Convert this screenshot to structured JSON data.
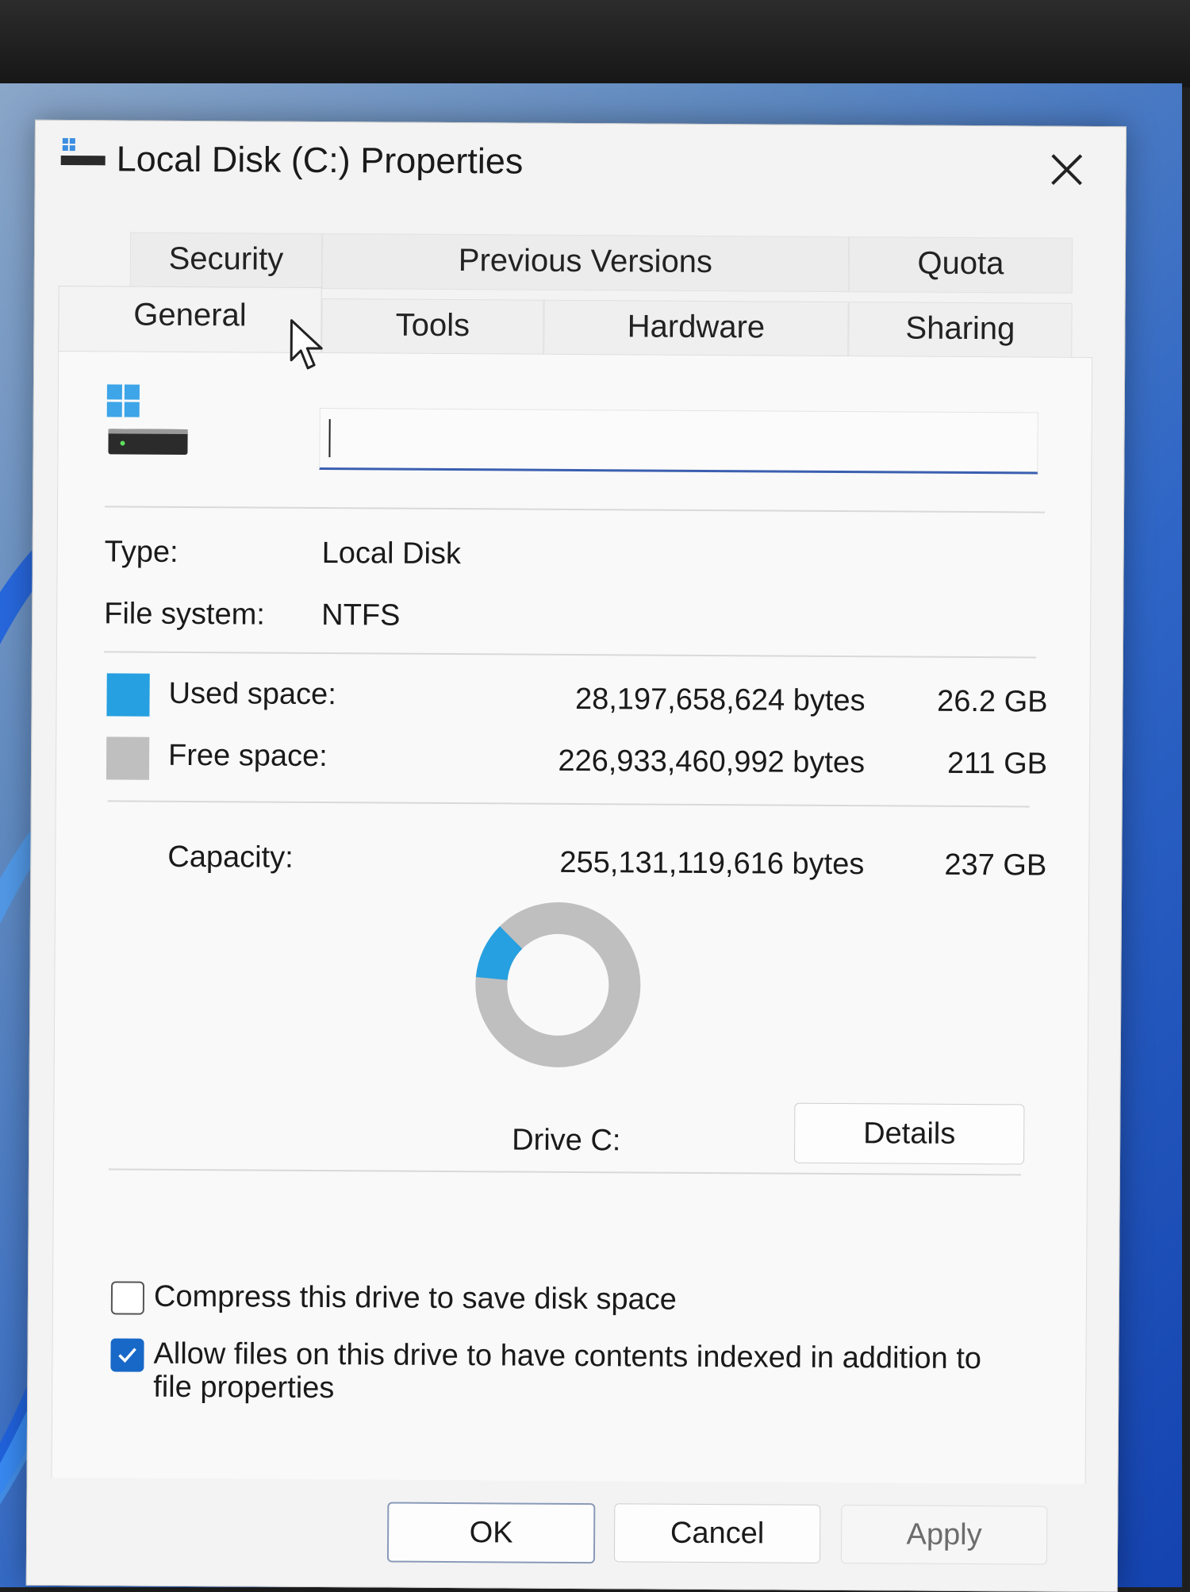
{
  "window": {
    "title": "Local Disk (C:) Properties",
    "close_icon": "close-icon"
  },
  "tabs": {
    "back_row": [
      "Security",
      "Previous Versions",
      "Quota"
    ],
    "front_row": [
      "General",
      "Tools",
      "Hardware",
      "Sharing"
    ],
    "active": "General"
  },
  "general": {
    "drive_label_value": "",
    "type_label": "Type:",
    "type_value": "Local Disk",
    "fs_label": "File system:",
    "fs_value": "NTFS",
    "used_label": "Used space:",
    "used_bytes": "28,197,658,624 bytes",
    "used_size": "26.2 GB",
    "free_label": "Free space:",
    "free_bytes": "226,933,460,992 bytes",
    "free_size": "211 GB",
    "capacity_label": "Capacity:",
    "capacity_bytes": "255,131,119,616 bytes",
    "capacity_size": "237 GB",
    "drive_caption": "Drive C:",
    "details_button": "Details",
    "used_fraction": 0.1105,
    "colors": {
      "used": "#26a0e0",
      "free": "#bfbfbf",
      "accent": "#1868c8"
    }
  },
  "options": {
    "compress_label": "Compress this drive to save disk space",
    "compress_checked": false,
    "index_label_line1": "Allow files on this drive to have contents indexed in addition to",
    "index_label_line2": "file properties",
    "index_checked": true
  },
  "footer": {
    "ok": "OK",
    "cancel": "Cancel",
    "apply": "Apply"
  }
}
